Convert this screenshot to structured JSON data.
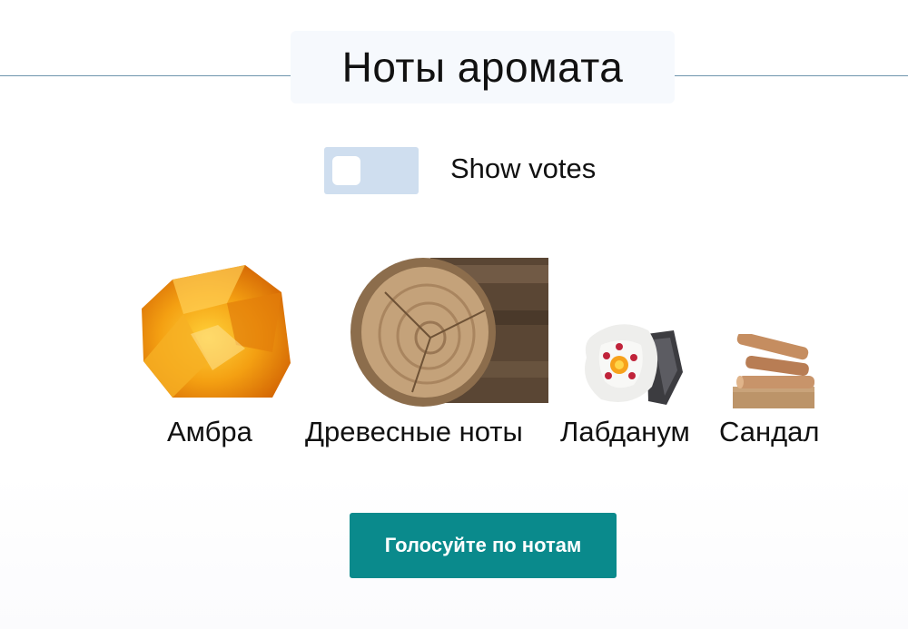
{
  "section": {
    "title": "Ноты аромата"
  },
  "votes_toggle": {
    "label": "Show votes",
    "state": "off"
  },
  "notes": [
    {
      "name": "Амбра",
      "icon": "amber-stone-icon"
    },
    {
      "name": "Древесные ноты",
      "icon": "wood-log-icon"
    },
    {
      "name": "Лабданум",
      "icon": "labdanum-flower-icon"
    },
    {
      "name": "Сандал",
      "icon": "sandalwood-sticks-icon"
    }
  ],
  "vote_button": {
    "label": "Голосуйте по нотам"
  },
  "colors": {
    "divider": "#6f96ad",
    "toggle_track": "#cfdeef",
    "button": "#0a8a8c"
  }
}
